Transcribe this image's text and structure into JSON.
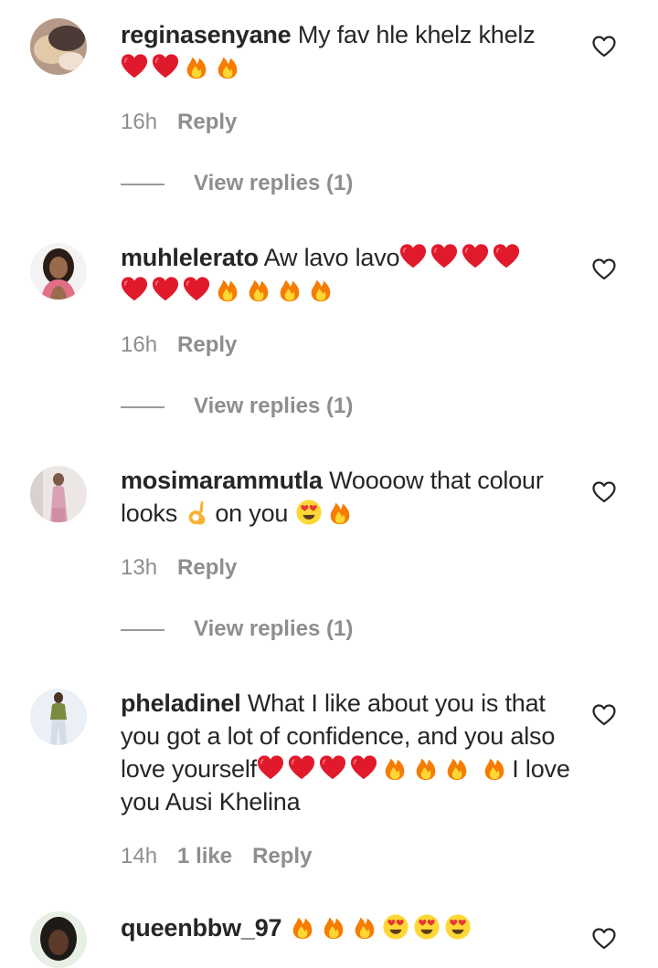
{
  "comments": [
    {
      "username": "reginasenyane",
      "text": "My fav hle khelz khelz",
      "emoji_line": "❤️❤️🔥🔥",
      "time": "16h",
      "likes": "",
      "reply_label": "Reply",
      "view_replies": "View replies (1)"
    },
    {
      "username": "muhlelerato",
      "text": "Aw lavo lavo❤️❤️❤️❤️",
      "emoji_line": "❤️❤️❤️🔥🔥🔥🔥",
      "time": "16h",
      "likes": "",
      "reply_label": "Reply",
      "view_replies": "View replies (1)"
    },
    {
      "username": "mosimarammutla",
      "text": "Woooow that colour looks 👌 on you 😍🔥",
      "time": "13h",
      "likes": "",
      "reply_label": "Reply",
      "view_replies": "View replies (1)"
    },
    {
      "username": "pheladinel",
      "text": "What I like about you is that you got a lot of confidence, and you also love yourself❤️❤️❤️❤️🔥🔥🔥🔥I love you Ausi Khelina",
      "time": "14h",
      "likes": "1 like",
      "reply_label": "Reply"
    },
    {
      "username": "queenbbw_97",
      "text": "🔥🔥🔥😍😍😍"
    }
  ],
  "icons": {
    "like": "heart-outline-icon",
    "emoji_heart": "red-heart",
    "emoji_fire": "fire",
    "emoji_ok": "ok-hand",
    "emoji_love_eyes": "heart-eyes-face"
  },
  "colors": {
    "text": "#262626",
    "meta": "#8e8e8e",
    "heart": "#e01a2b",
    "fire": "#f7a21b"
  }
}
